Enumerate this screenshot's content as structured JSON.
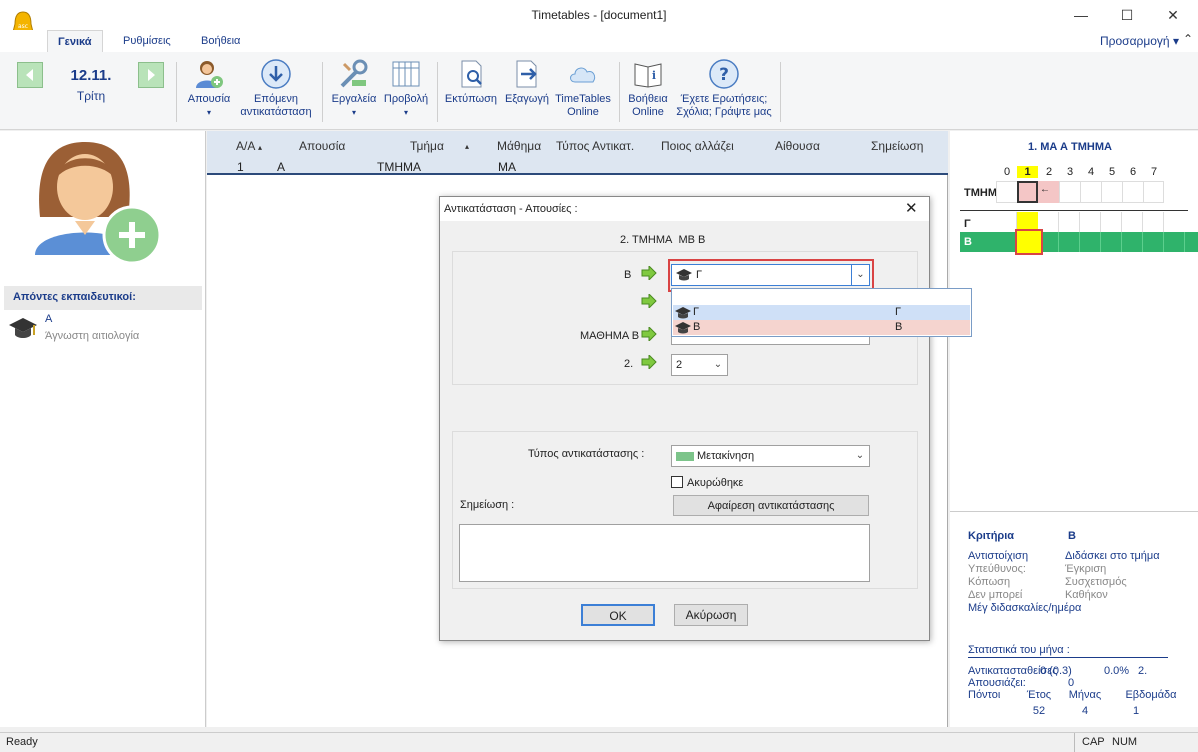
{
  "window": {
    "title": "Timetables - [document1]"
  },
  "tabs": [
    "Γενικά",
    "Ρυθμίσεις",
    "Βοήθεια"
  ],
  "customize": "Προσαρμογή",
  "date": {
    "day": "12.11.",
    "weekday": "Τρίτη"
  },
  "ribbon": {
    "absence": "Απουσία",
    "next_sub_1": "Επόμενη",
    "next_sub_2": "αντικατάσταση",
    "tools": "Εργαλεία",
    "view": "Προβολή",
    "print": "Εκτύπωση",
    "export": "Εξαγωγή",
    "online_1": "TimeTables",
    "online_2": "Online",
    "help_1": "Βοήθεια",
    "help_2": "Online",
    "questions_1": "Έχετε Ερωτήσεις;",
    "questions_2": "Σχόλια; Γράψτε μας"
  },
  "left": {
    "absent_title": "Απόντες εκπαιδευτικοί:",
    "teacher_name": "Α",
    "teacher_reason": "Άγνωστη αιτιολογία"
  },
  "grid": {
    "headers": [
      "Α/Α",
      "Απουσία",
      "Τμήμα",
      "Μάθημα",
      "Τύπος Αντικατ.",
      "Ποιος αλλάζει",
      "Αίθουσα",
      "Σημείωση"
    ],
    "row": {
      "aa": "1",
      "absence": "Α",
      "class": "ΤΜΗΜΑ",
      "subject": "ΜΑ"
    }
  },
  "dialog": {
    "title": "Αντικατάσταση - Απουσίες :",
    "header": "2. ΤΜΗΜΑ",
    "header_sub": "ΜΒ Β",
    "row1_label": "Β",
    "combo_value": "Γ",
    "dropdown": [
      {
        "left": "Γ",
        "right": "Γ"
      },
      {
        "left": "Β",
        "right": "Β"
      }
    ],
    "row3_label": "ΜΑΘΗΜΑ Β",
    "row4_label": "2.",
    "row4_value": "2",
    "type_label": "Τύπος αντικατάστασης :",
    "type_value": "Μετακίνηση",
    "cancelled": "Ακυρώθηκε",
    "note_label": "Σημείωση :",
    "remove_btn": "Αφαίρεση αντικατάστασης",
    "ok": "OK",
    "cancel": "Ακύρωση"
  },
  "right": {
    "title": "1. ΜΑ Α ΤΜΗΜΑ",
    "periods": [
      "0",
      "1",
      "2",
      "3",
      "4",
      "5",
      "6",
      "7"
    ],
    "row_labels": [
      "ΤΜΗΜ",
      "Γ",
      "Β"
    ],
    "criteria_label": "Κριτήρια",
    "criteria_value": "Β",
    "criteria": [
      {
        "left": "Αντιστοίχιση",
        "right": "Διδάσκει στο τμήμα",
        "active": true
      },
      {
        "left": "Υπεύθυνος:",
        "right": "Έγκριση",
        "active": false
      },
      {
        "left": "Κόπωση",
        "right": "Συσχετισμός",
        "active": false
      },
      {
        "left": "Δεν μπορεί",
        "right": "Καθήκον",
        "active": false
      }
    ],
    "max_lessons": "Μέγ διδασκαλίες/ημέρα",
    "stats_title": "Στατιστικά του μήνα :",
    "stats_line1_label": "Αντικατασταθείσες",
    "stats_line1_v1": "0 (0.3)",
    "stats_line1_v2": "0.0%",
    "stats_line1_v3": "2.",
    "stats_line2_label": "Απουσιάζει:",
    "stats_line2_v1": "0",
    "points_label": "Πόντοι",
    "cols": [
      "Έτος",
      "Μήνας",
      "Εβδομάδα"
    ],
    "vals": [
      "52",
      "4",
      "1"
    ]
  },
  "status": {
    "ready": "Ready",
    "cap": "CAP",
    "num": "NUM"
  }
}
